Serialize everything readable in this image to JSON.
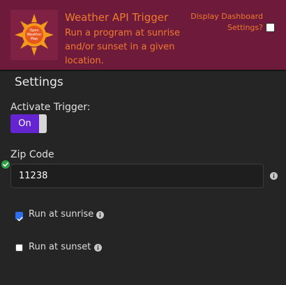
{
  "header": {
    "logo_text": [
      "Open",
      "Weather",
      "Map"
    ],
    "title": "Weather API Trigger",
    "description": "Run a program at sunrise and/or sunset in a given location.",
    "dashboard_label_line1": "Display Dashboard",
    "dashboard_label_line2": "Settings?",
    "dashboard_checked": false
  },
  "settings": {
    "heading": "Settings",
    "activate_label": "Activate Trigger:",
    "toggle_label": "On",
    "zip_label": "Zip Code",
    "zip_value": "11238",
    "sunrise_label": "Run at sunrise",
    "sunrise_checked": true,
    "sunset_label": "Run at sunset",
    "sunset_checked": false
  },
  "colors": {
    "header_bg": "#6e1a3a",
    "accent_text": "#f07a2d",
    "toggle_on": "#6425d0",
    "checkbox_checked": "#2f6feb",
    "valid_green": "#2e9e46"
  }
}
